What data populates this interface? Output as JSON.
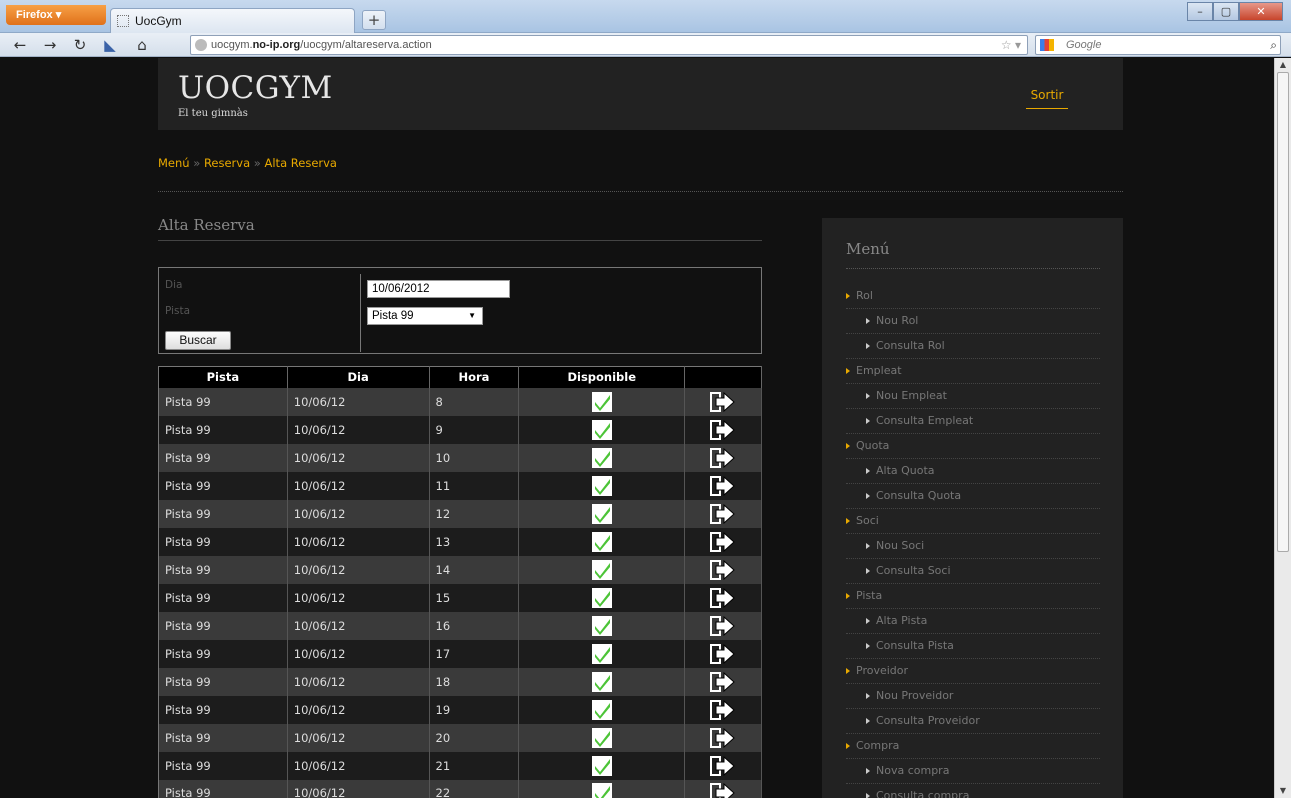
{
  "browser": {
    "app_button": "Firefox",
    "tab_title": "UocGym",
    "new_tab": "+",
    "url_host_prefix": "uocgym.",
    "url_host_bold": "no-ip.org",
    "url_path": "/uocgym/altareserva.action",
    "search_engine": "Google"
  },
  "header": {
    "logo": "UOCGYM",
    "tagline": "El teu gimnàs",
    "logout": "Sortir"
  },
  "breadcrumb": {
    "items": [
      "Menú",
      "Reserva",
      "Alta Reserva"
    ],
    "separator": "»"
  },
  "content": {
    "title": "Alta Reserva",
    "form": {
      "day_label": "Dia",
      "day_value": "10/06/2012",
      "court_label": "Pista",
      "court_value": "Pista 99",
      "search_button": "Buscar"
    },
    "table": {
      "columns": [
        "Pista",
        "Dia",
        "Hora",
        "Disponible",
        ""
      ],
      "rows": [
        {
          "pista": "Pista 99",
          "dia": "10/06/12",
          "hora": "8"
        },
        {
          "pista": "Pista 99",
          "dia": "10/06/12",
          "hora": "9"
        },
        {
          "pista": "Pista 99",
          "dia": "10/06/12",
          "hora": "10"
        },
        {
          "pista": "Pista 99",
          "dia": "10/06/12",
          "hora": "11"
        },
        {
          "pista": "Pista 99",
          "dia": "10/06/12",
          "hora": "12"
        },
        {
          "pista": "Pista 99",
          "dia": "10/06/12",
          "hora": "13"
        },
        {
          "pista": "Pista 99",
          "dia": "10/06/12",
          "hora": "14"
        },
        {
          "pista": "Pista 99",
          "dia": "10/06/12",
          "hora": "15"
        },
        {
          "pista": "Pista 99",
          "dia": "10/06/12",
          "hora": "16"
        },
        {
          "pista": "Pista 99",
          "dia": "10/06/12",
          "hora": "17"
        },
        {
          "pista": "Pista 99",
          "dia": "10/06/12",
          "hora": "18"
        },
        {
          "pista": "Pista 99",
          "dia": "10/06/12",
          "hora": "19"
        },
        {
          "pista": "Pista 99",
          "dia": "10/06/12",
          "hora": "20"
        },
        {
          "pista": "Pista 99",
          "dia": "10/06/12",
          "hora": "21"
        },
        {
          "pista": "Pista 99",
          "dia": "10/06/12",
          "hora": "22"
        }
      ],
      "available_icon": "check-icon",
      "action_icon": "reserve-arrow-icon"
    }
  },
  "sidebar": {
    "title": "Menú",
    "items": [
      {
        "label": "Rol",
        "level": 1
      },
      {
        "label": "Nou Rol",
        "level": 2
      },
      {
        "label": "Consulta Rol",
        "level": 2
      },
      {
        "label": "Empleat",
        "level": 1
      },
      {
        "label": "Nou Empleat",
        "level": 2
      },
      {
        "label": "Consulta Empleat",
        "level": 2
      },
      {
        "label": "Quota",
        "level": 1
      },
      {
        "label": "Alta Quota",
        "level": 2
      },
      {
        "label": "Consulta Quota",
        "level": 2
      },
      {
        "label": "Soci",
        "level": 1
      },
      {
        "label": "Nou Soci",
        "level": 2
      },
      {
        "label": "Consulta Soci",
        "level": 2
      },
      {
        "label": "Pista",
        "level": 1
      },
      {
        "label": "Alta Pista",
        "level": 2
      },
      {
        "label": "Consulta Pista",
        "level": 2
      },
      {
        "label": "Proveidor",
        "level": 1
      },
      {
        "label": "Nou Proveidor",
        "level": 2
      },
      {
        "label": "Consulta Proveidor",
        "level": 2
      },
      {
        "label": "Compra",
        "level": 1
      },
      {
        "label": "Nova compra",
        "level": 2
      },
      {
        "label": "Consulta compra",
        "level": 2
      }
    ]
  },
  "colors": {
    "accent": "#e8a900",
    "background": "#111111",
    "panel": "#222222",
    "check_green": "#4cc437"
  }
}
